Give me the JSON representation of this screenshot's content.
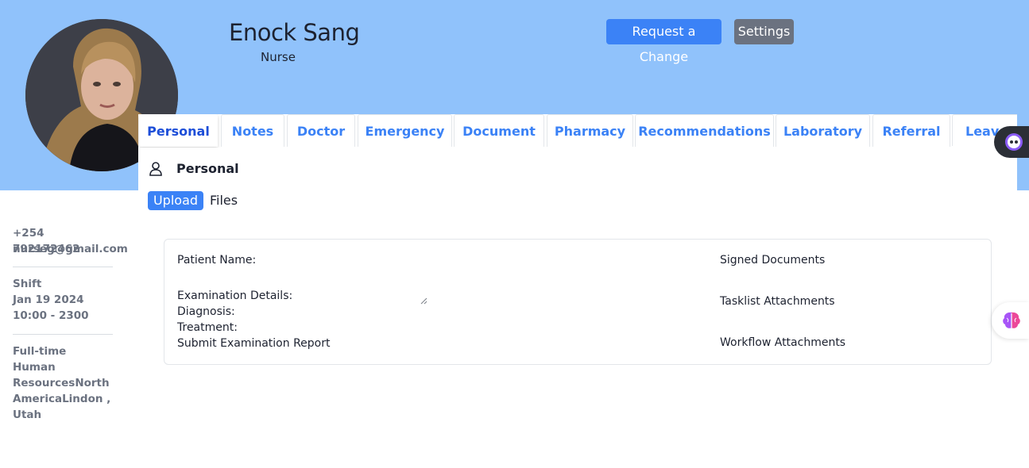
{
  "profile": {
    "name": "Enock Sang",
    "role": "Nurse"
  },
  "header_buttons": {
    "request_change": "Request a Change",
    "settings": "Settings"
  },
  "tabs": [
    {
      "label": "Personal",
      "active": true
    },
    {
      "label": "Notes",
      "active": false
    },
    {
      "label": "Doctor",
      "active": false
    },
    {
      "label": "Emergency",
      "active": false
    },
    {
      "label": "Document",
      "active": false
    },
    {
      "label": "Pharmacy",
      "active": false
    },
    {
      "label": "Recommendations",
      "active": false
    },
    {
      "label": "Laboratory",
      "active": false
    },
    {
      "label": "Referral",
      "active": false
    },
    {
      "label": "Leave",
      "active": false
    }
  ],
  "section": {
    "title": "Personal",
    "icon": "user-icon",
    "upload_label": "Upload",
    "files_label": "Files"
  },
  "contact": {
    "phone": "+254 792172462",
    "email": "nurseg@gmail.com"
  },
  "shift": {
    "label": "Shift",
    "date": "Jan 19 2024",
    "hours": "10:00 - 2300"
  },
  "employment": {
    "type": "Full-time",
    "line1": "Human",
    "line2": "ResourcesNorth",
    "line3": "AmericaLindon ,",
    "line4": "Utah"
  },
  "exam_card": {
    "patient_name": "Patient Name:",
    "examination_details": "Examination Details:",
    "diagnosis": "Diagnosis:",
    "treatment": "Treatment:",
    "submit": "Submit Examination Report",
    "signed_documents": "Signed Documents",
    "tasklist_attachments": "Tasklist Attachments",
    "workflow_attachments": "Workflow Attachments"
  },
  "colors": {
    "banner": "#90c2fb",
    "primary": "#3b82f6",
    "secondary": "#6b7280"
  }
}
